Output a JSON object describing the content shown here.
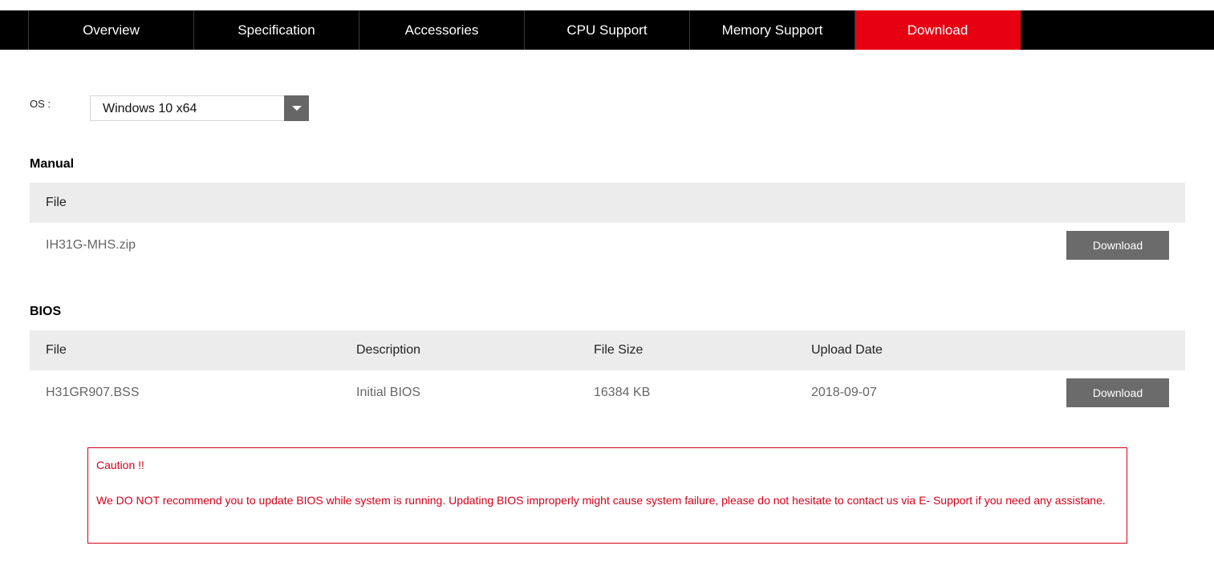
{
  "nav": {
    "tabs": [
      {
        "label": "Overview",
        "active": false
      },
      {
        "label": "Specification",
        "active": false
      },
      {
        "label": "Accessories",
        "active": false
      },
      {
        "label": "CPU Support",
        "active": false
      },
      {
        "label": "Memory Support",
        "active": false
      },
      {
        "label": "Download",
        "active": true
      }
    ],
    "accent_color": "#e60012"
  },
  "os": {
    "label": "OS :",
    "selected": "Windows 10 x64",
    "icon": "dropdown-arrow-icon"
  },
  "manual": {
    "title": "Manual",
    "columns": [
      "File"
    ],
    "rows": [
      {
        "file": "IH31G-MHS.zip",
        "button": "Download"
      }
    ]
  },
  "bios": {
    "title": "BIOS",
    "columns": [
      "File",
      "Description",
      "File Size",
      "Upload Date"
    ],
    "rows": [
      {
        "file": "H31GR907.BSS",
        "description": "Initial BIOS",
        "size": "16384 KB",
        "date": "2018-09-07",
        "button": "Download"
      }
    ]
  },
  "caution": {
    "title": "Caution !!",
    "body": "We DO NOT recommend you to update BIOS while system is running. Updating BIOS improperly might cause system failure, please do not hesitate to contact us via E- Support if you need any assistane.",
    "color": "#d4001a"
  }
}
